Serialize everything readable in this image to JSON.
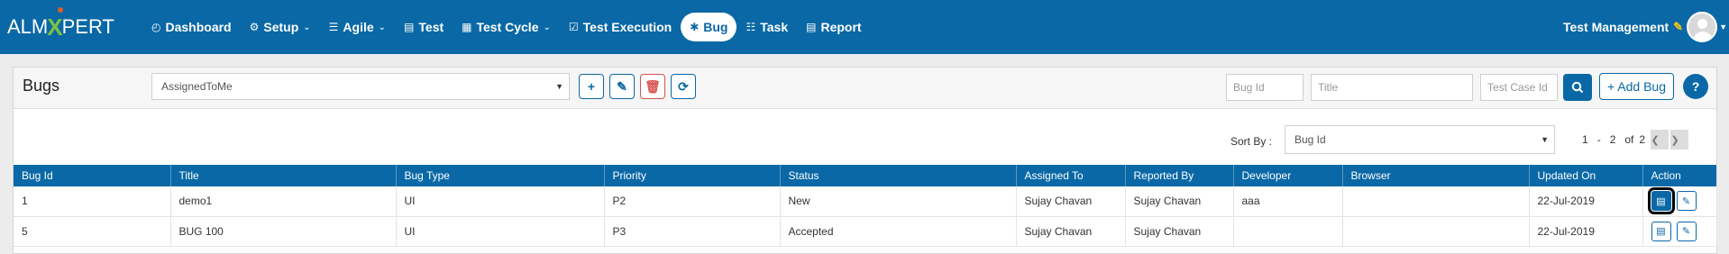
{
  "brand": {
    "logo_left": "ALM",
    "logo_x": "X",
    "logo_right": "PERT"
  },
  "nav": [
    {
      "label": "Dashboard",
      "icon": "dashboard-icon",
      "glyph": "◴"
    },
    {
      "label": "Setup",
      "icon": "cogs-icon",
      "glyph": "⚙"
    },
    {
      "label": "Agile",
      "icon": "list-icon",
      "glyph": "☰"
    },
    {
      "label": "Test",
      "icon": "file-icon",
      "glyph": "▤"
    },
    {
      "label": "Test Cycle",
      "icon": "table-icon",
      "glyph": "▦"
    },
    {
      "label": "Test Execution",
      "icon": "check-square-icon",
      "glyph": "☑"
    },
    {
      "label": "Bug",
      "icon": "bug-icon",
      "glyph": "✱"
    },
    {
      "label": "Task",
      "icon": "tasks-icon",
      "glyph": "☷"
    },
    {
      "label": "Report",
      "icon": "report-icon",
      "glyph": "▤"
    }
  ],
  "user": {
    "project": "Test Management"
  },
  "panel": {
    "title": "Bugs",
    "filter_value": "AssignedToMe",
    "search": {
      "bug_id_placeholder": "Bug Id",
      "title_placeholder": "Title",
      "test_case_placeholder": "Test Case Id"
    },
    "add_bug_label": "+ Add Bug",
    "help_label": "?"
  },
  "sort": {
    "label": "Sort By :",
    "value": "Bug Id"
  },
  "pagination": {
    "from": "1",
    "dash": "-",
    "to": "2",
    "of": "of",
    "total": "2"
  },
  "table": {
    "headers": [
      "Bug Id",
      "Title",
      "Bug Type",
      "Priority",
      "Status",
      "Assigned To",
      "Reported By",
      "Developer",
      "Browser",
      "Updated On",
      "Action"
    ],
    "rows": [
      [
        "1",
        "demo1",
        "UI",
        "P2",
        "New",
        "Sujay Chavan",
        "Sujay Chavan",
        "aaa",
        "",
        "22-Jul-2019"
      ],
      [
        "5",
        "BUG 100",
        "UI",
        "P3",
        "Accepted",
        "Sujay Chavan",
        "Sujay Chavan",
        "",
        "",
        "22-Jul-2019"
      ]
    ]
  },
  "colors": {
    "primary": "#0a68a6",
    "accent": "#7cc242",
    "danger": "#d9534f"
  }
}
